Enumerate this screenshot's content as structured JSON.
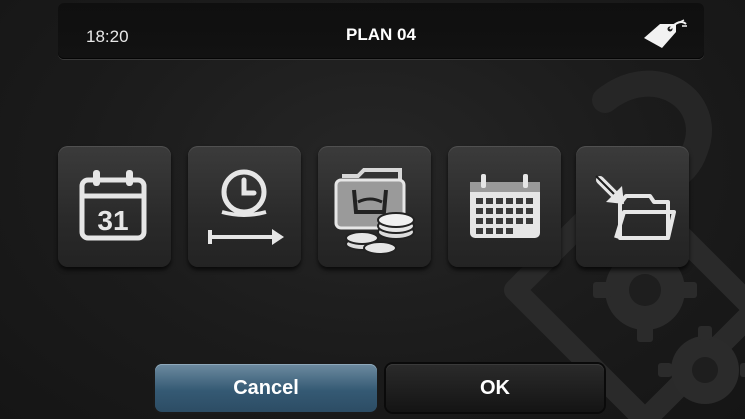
{
  "header": {
    "time": "18:20",
    "title": "PLAN 04",
    "tag_icon": "price-tag-icon"
  },
  "tiles": [
    {
      "id": "calendar-day",
      "icon": "calendar-day-icon",
      "day_number": "31"
    },
    {
      "id": "timer",
      "icon": "clock-timer-arrow-icon"
    },
    {
      "id": "wash-cost",
      "icon": "folder-wash-coins-icon"
    },
    {
      "id": "calendar-month",
      "icon": "calendar-month-icon"
    },
    {
      "id": "import",
      "icon": "folder-import-arrow-icon"
    }
  ],
  "buttons": {
    "cancel_label": "Cancel",
    "ok_label": "OK"
  },
  "colors": {
    "background": "#1c1c1c",
    "cancel_accent": "#355a74",
    "text": "#ffffff"
  }
}
